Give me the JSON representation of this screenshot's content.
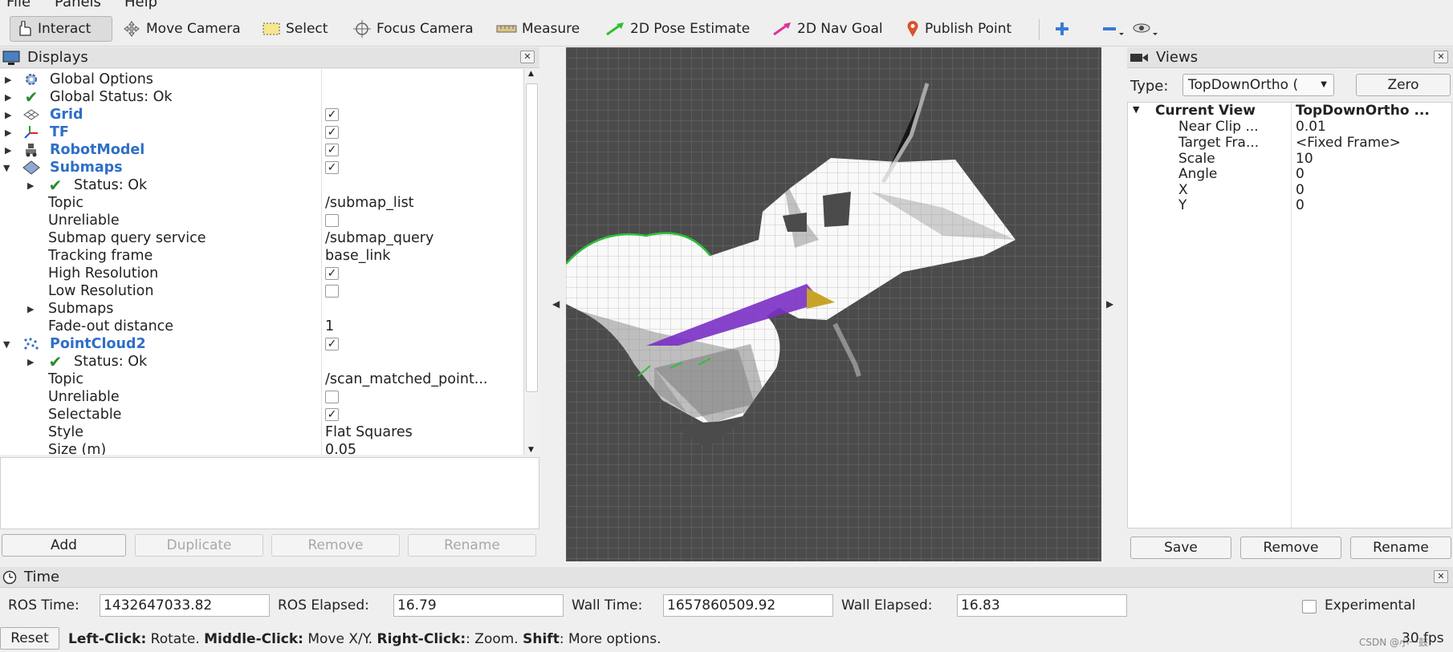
{
  "menu": [
    "File",
    "Panels",
    "Help"
  ],
  "toolbar": {
    "tools": [
      {
        "label": "Interact",
        "icon": "hand-icon",
        "active": true
      },
      {
        "label": "Move Camera",
        "icon": "move-camera-icon"
      },
      {
        "label": "Select",
        "icon": "select-icon"
      },
      {
        "label": "Focus Camera",
        "icon": "focus-camera-icon"
      },
      {
        "label": "Measure",
        "icon": "ruler-icon"
      },
      {
        "label": "2D Pose Estimate",
        "icon": "pose-arrow-icon"
      },
      {
        "label": "2D Nav Goal",
        "icon": "nav-goal-arrow-icon"
      },
      {
        "label": "Publish Point",
        "icon": "map-pin-icon"
      }
    ],
    "extra_icons": [
      "plus-icon",
      "minus-icon",
      "eye-icon"
    ]
  },
  "displays": {
    "title": "Displays",
    "rows": [
      {
        "name": "Global Options"
      },
      {
        "name": "Global Status: Ok"
      },
      {
        "name": "Grid",
        "checked": true
      },
      {
        "name": "TF",
        "checked": true
      },
      {
        "name": "RobotModel",
        "checked": true
      },
      {
        "name": "Submaps",
        "checked": true
      },
      {
        "name": "Status: Ok"
      },
      {
        "name": "Topic",
        "value": "/submap_list"
      },
      {
        "name": "Unreliable",
        "checked": false
      },
      {
        "name": "Submap query service",
        "value": "/submap_query"
      },
      {
        "name": "Tracking frame",
        "value": "base_link"
      },
      {
        "name": "High Resolution",
        "checked": true
      },
      {
        "name": "Low Resolution",
        "checked": false
      },
      {
        "name": "Submaps"
      },
      {
        "name": "Fade-out distance",
        "value": "1"
      },
      {
        "name": "PointCloud2",
        "checked": true
      },
      {
        "name": "Status: Ok"
      },
      {
        "name": "Topic",
        "value": "/scan_matched_point..."
      },
      {
        "name": "Unreliable",
        "checked": false
      },
      {
        "name": "Selectable",
        "checked": true
      },
      {
        "name": "Style",
        "value": "Flat Squares"
      },
      {
        "name": "Size (m)",
        "value": "0.05"
      }
    ],
    "buttons": [
      "Add",
      "Duplicate",
      "Remove",
      "Rename"
    ]
  },
  "views": {
    "title": "Views",
    "type_label": "Type:",
    "type_value": "TopDownOrtho (",
    "zero_button": "Zero",
    "current_view_label": "Current View",
    "current_view_value": "TopDownOrtho ...",
    "props": [
      {
        "name": "Near Clip ...",
        "value": "0.01"
      },
      {
        "name": "Target Fra...",
        "value": "<Fixed Frame>"
      },
      {
        "name": "Scale",
        "value": "10"
      },
      {
        "name": "Angle",
        "value": "0"
      },
      {
        "name": "X",
        "value": "0"
      },
      {
        "name": "Y",
        "value": "0"
      }
    ],
    "buttons": [
      "Save",
      "Remove",
      "Rename"
    ]
  },
  "time": {
    "title": "Time",
    "ros_time_label": "ROS Time:",
    "ros_time": "1432647033.82",
    "ros_elapsed_label": "ROS Elapsed:",
    "ros_elapsed": "16.79",
    "wall_time_label": "Wall Time:",
    "wall_time": "1657860509.92",
    "wall_elapsed_label": "Wall Elapsed:",
    "wall_elapsed": "16.83",
    "experimental_label": "Experimental",
    "experimental_checked": false
  },
  "status": {
    "reset_label": "Reset",
    "hint_parts": [
      {
        "text": "Left-Click:",
        "bold": true
      },
      {
        "text": " Rotate. ",
        "bold": false
      },
      {
        "text": "Middle-Click:",
        "bold": true
      },
      {
        "text": " Move X/Y. ",
        "bold": false
      },
      {
        "text": "Right-Click:",
        "bold": true
      },
      {
        "text": ": Zoom. ",
        "bold": false
      },
      {
        "text": "Shift",
        "bold": true
      },
      {
        "text": ": More options.",
        "bold": false
      }
    ],
    "watermark": "CSDN @小一鼓",
    "fps": "30 fps"
  },
  "colors": {
    "grid_bg": "#4b4b4b",
    "blue_name": "#2f6fc7",
    "ok_check": "#2a8a2a",
    "purple_cloud": "#7a2fc4",
    "gold_cloud": "#c8a32a"
  }
}
